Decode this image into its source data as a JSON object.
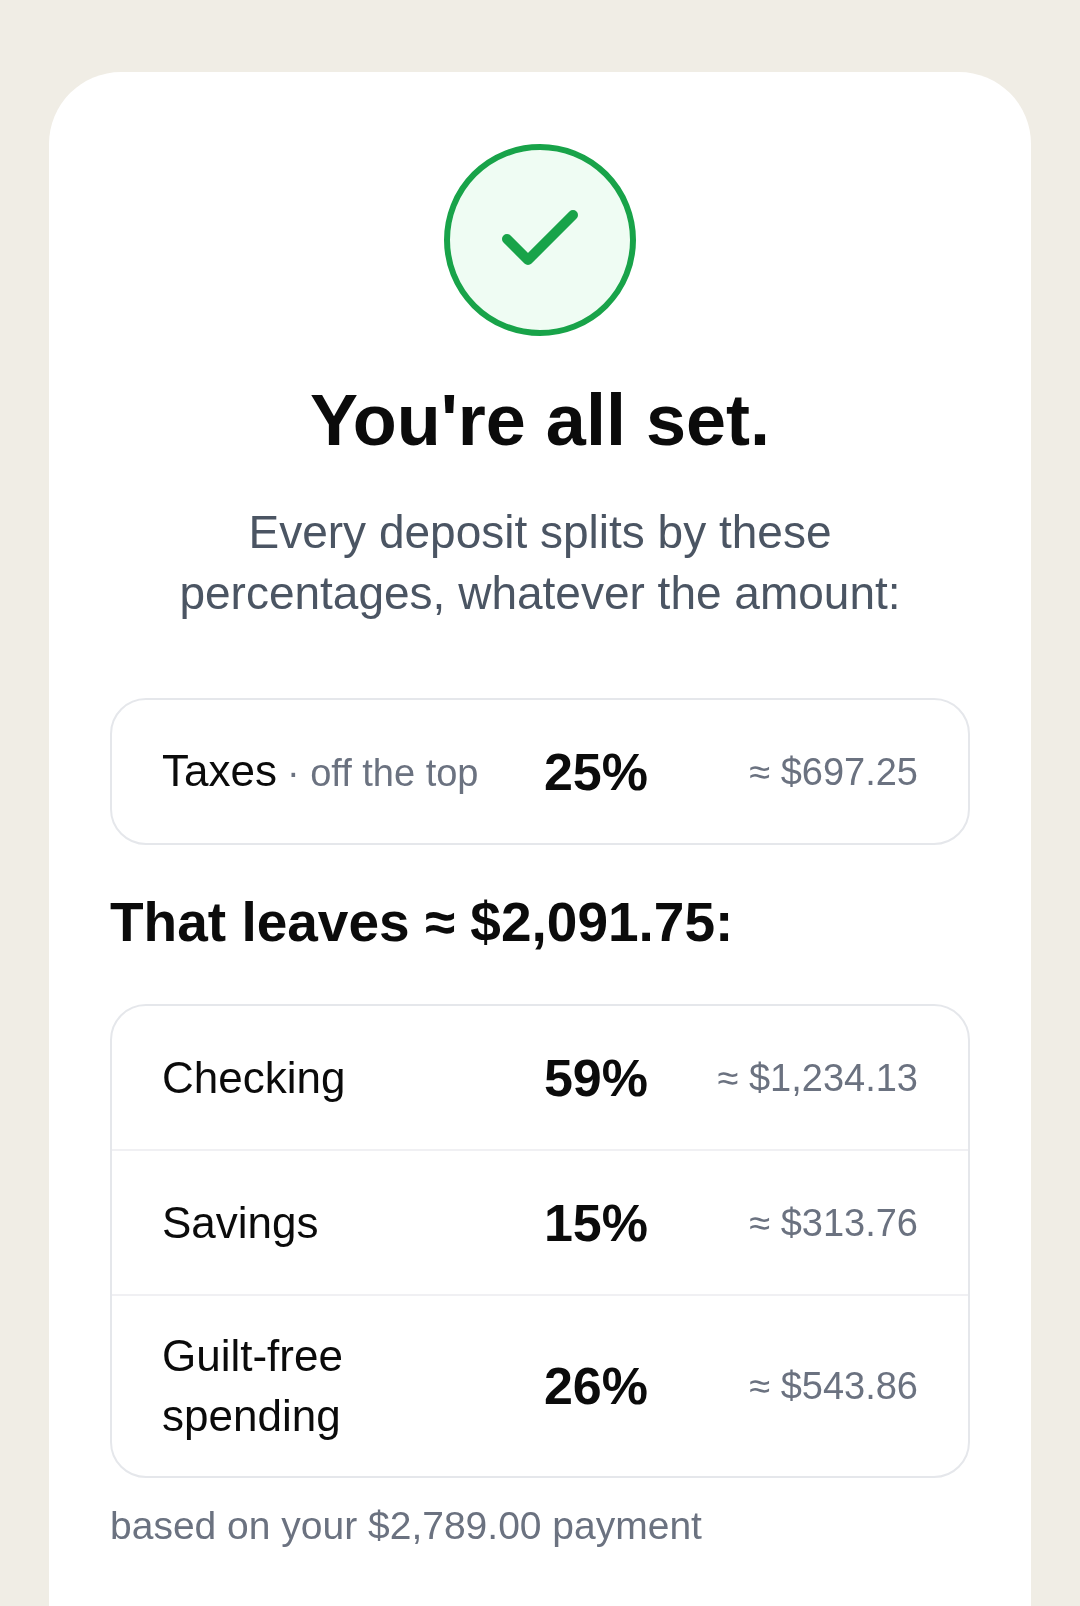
{
  "header": {
    "title": "You're all set.",
    "subtitle": "Every deposit splits by these percentages, whatever the amount:"
  },
  "taxes": {
    "name": "Taxes",
    "note": "· off the top",
    "percent": "25%",
    "amount": "≈ $697.25"
  },
  "remainder": {
    "text": "That leaves ≈ $2,091.75:"
  },
  "allocations": [
    {
      "name": "Checking",
      "percent": "59%",
      "amount": "≈ $1,234.13"
    },
    {
      "name": "Savings",
      "percent": "15%",
      "amount": "≈ $313.76"
    },
    {
      "name": "Guilt-free spending",
      "percent": "26%",
      "amount": "≈ $543.86"
    }
  ],
  "footnote": "based on your $2,789.00 payment"
}
